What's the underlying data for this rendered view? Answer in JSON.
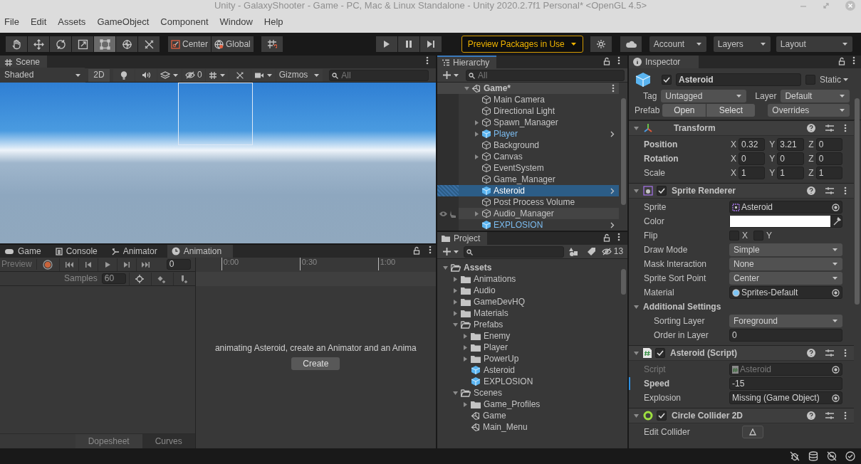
{
  "window": {
    "title": "Unity - GalaxyShooter - Game - PC, Mac & Linux Standalone - Unity 2020.2.7f1 Personal* <OpenGL 4.5>"
  },
  "menu": [
    "File",
    "Edit",
    "Assets",
    "GameObject",
    "Component",
    "Window",
    "Help"
  ],
  "toolbar": {
    "tools": [
      {
        "kind": "hand",
        "selected": false
      },
      {
        "kind": "move",
        "selected": false
      },
      {
        "kind": "rotate",
        "selected": false
      },
      {
        "kind": "scale",
        "selected": false
      },
      {
        "kind": "rect",
        "selected": true
      },
      {
        "kind": "transform",
        "selected": false
      },
      {
        "kind": "custom",
        "selected": false
      }
    ],
    "pivot": "Center",
    "space": "Global",
    "preview_packages": "Preview Packages in Use",
    "account": "Account",
    "layers": "Layers",
    "layout": "Layout"
  },
  "scene": {
    "tab": "Scene",
    "shading": "Shaded",
    "mode_2d": "2D",
    "hidden_count": "0",
    "gizmos": "Gizmos",
    "search_placeholder": "All"
  },
  "animation": {
    "tabs": [
      {
        "label": "Game",
        "kind": "game",
        "selected": false
      },
      {
        "label": "Console",
        "kind": "console",
        "selected": false
      },
      {
        "label": "Animator",
        "kind": "animator",
        "selected": false
      },
      {
        "label": "Animation",
        "kind": "animation",
        "selected": true
      }
    ],
    "preview": "Preview",
    "frame": "0",
    "samples_label": "Samples",
    "samples": "60",
    "time_ticks": [
      "0:00",
      "0:30",
      "1:00"
    ],
    "message": "animating Asteroid, create an Animator and an Anima",
    "create_button": "Create",
    "bottom_tabs": [
      {
        "label": "Dopesheet",
        "selected": true
      },
      {
        "label": "Curves",
        "selected": false
      }
    ]
  },
  "hierarchy": {
    "tab": "Hierarchy",
    "search_placeholder": "All",
    "scene": {
      "name": "Game*",
      "expanded": true,
      "children": [
        {
          "name": "Main Camera",
          "kind": "object",
          "selected": false
        },
        {
          "name": "Directional Light",
          "kind": "object",
          "selected": false
        },
        {
          "name": "Spawn_Manager",
          "kind": "object",
          "expanded": false,
          "selected": false
        },
        {
          "name": "Player",
          "kind": "prefab",
          "expanded": false,
          "selected": false
        },
        {
          "name": "Background",
          "kind": "object",
          "selected": false
        },
        {
          "name": "Canvas",
          "kind": "object",
          "expanded": false,
          "selected": false
        },
        {
          "name": "EventSystem",
          "kind": "object",
          "selected": false
        },
        {
          "name": "Game_Manager",
          "kind": "object",
          "selected": false
        },
        {
          "name": "Asteroid",
          "kind": "prefab",
          "selected": true
        },
        {
          "name": "Post Process Volume",
          "kind": "object",
          "selected": false
        },
        {
          "name": "Audio_Manager",
          "kind": "object",
          "expanded": false,
          "selected": false,
          "hovered": true
        },
        {
          "name": "EXPLOSION",
          "kind": "prefab",
          "selected": false
        }
      ]
    }
  },
  "project": {
    "tab": "Project",
    "hidden_count": "13",
    "tree": [
      {
        "name": "Assets",
        "kind": "folder",
        "expanded": true,
        "children": [
          {
            "name": "Animations",
            "kind": "folder",
            "expanded": false
          },
          {
            "name": "Audio",
            "kind": "folder",
            "expanded": false
          },
          {
            "name": "GameDevHQ",
            "kind": "folder",
            "expanded": false
          },
          {
            "name": "Materials",
            "kind": "folder",
            "expanded": false
          },
          {
            "name": "Prefabs",
            "kind": "folder",
            "expanded": true,
            "children": [
              {
                "name": "Enemy",
                "kind": "folder",
                "expanded": false
              },
              {
                "name": "Player",
                "kind": "folder",
                "expanded": false
              },
              {
                "name": "PowerUp",
                "kind": "folder",
                "expanded": false
              },
              {
                "name": "Asteroid",
                "kind": "prefab"
              },
              {
                "name": "EXPLOSION",
                "kind": "prefab"
              }
            ]
          },
          {
            "name": "Scenes",
            "kind": "folder",
            "expanded": true,
            "children": [
              {
                "name": "Game_Profiles",
                "kind": "folder",
                "expanded": false
              },
              {
                "name": "Game",
                "kind": "scene"
              },
              {
                "name": "Main_Menu",
                "kind": "scene"
              }
            ]
          }
        ]
      }
    ]
  },
  "inspector": {
    "tab": "Inspector",
    "object": {
      "active": true,
      "name": "Asteroid",
      "static": false,
      "static_label": "Static",
      "tag_label": "Tag",
      "tag": "Untagged",
      "layer_label": "Layer",
      "layer": "Default",
      "prefab_label": "Prefab",
      "open": "Open",
      "select": "Select",
      "overrides": "Overrides"
    },
    "components": [
      {
        "title": "Transform",
        "kind": "transform",
        "expanded": true,
        "fields": [
          {
            "kind": "vector3",
            "label": "Position",
            "overridden": true,
            "values": [
              {
                "axis": "X",
                "value": "0.32"
              },
              {
                "axis": "Y",
                "value": "3.21"
              },
              {
                "axis": "Z",
                "value": "0"
              }
            ]
          },
          {
            "kind": "vector3",
            "label": "Rotation",
            "overridden": true,
            "values": [
              {
                "axis": "X",
                "value": "0"
              },
              {
                "axis": "Y",
                "value": "0"
              },
              {
                "axis": "Z",
                "value": "0"
              }
            ]
          },
          {
            "kind": "vector3",
            "label": "Scale",
            "overridden": false,
            "values": [
              {
                "axis": "X",
                "value": "1"
              },
              {
                "axis": "Y",
                "value": "1"
              },
              {
                "axis": "Z",
                "value": "1"
              }
            ]
          }
        ]
      },
      {
        "title": "Sprite Renderer",
        "kind": "sprite",
        "enabled": true,
        "expanded": true,
        "fields": [
          {
            "kind": "object",
            "label": "Sprite",
            "asset": {
              "kind": "sprite",
              "name": "Asteroid"
            }
          },
          {
            "kind": "color",
            "label": "Color",
            "color": "#ffffff"
          },
          {
            "kind": "flip",
            "label": "Flip",
            "options": [
              {
                "label": "X",
                "checked": false
              },
              {
                "label": "Y",
                "checked": false
              }
            ]
          },
          {
            "kind": "dropdown",
            "label": "Draw Mode",
            "value": "Simple"
          },
          {
            "kind": "dropdown",
            "label": "Mask Interaction",
            "value": "None"
          },
          {
            "kind": "dropdown",
            "label": "Sprite Sort Point",
            "value": "Center"
          },
          {
            "kind": "object",
            "label": "Material",
            "asset": {
              "kind": "material",
              "name": "Sprites-Default"
            }
          },
          {
            "kind": "group",
            "label": "Additional Settings",
            "expanded": true,
            "children": [
              {
                "kind": "dropdown",
                "label": "Sorting Layer",
                "value": "Foreground"
              },
              {
                "kind": "text",
                "label": "Order in Layer",
                "value": "0"
              }
            ]
          }
        ]
      },
      {
        "title": "Asteroid (Script)",
        "kind": "script",
        "enabled": true,
        "expanded": true,
        "fields": [
          {
            "kind": "object",
            "label": "Script",
            "asset": {
              "kind": "script",
              "name": "Asteroid"
            },
            "disabled": true
          },
          {
            "kind": "text",
            "label": "Speed",
            "value": "-15",
            "overridden": true
          },
          {
            "kind": "object",
            "label": "Explosion",
            "asset": {
              "name": "Missing (Game Object)"
            }
          }
        ]
      },
      {
        "title": "Circle Collider 2D",
        "kind": "collider",
        "enabled": true,
        "expanded": true,
        "fields": [
          {
            "kind": "edit_collider",
            "label": "Edit Collider"
          }
        ]
      }
    ]
  }
}
